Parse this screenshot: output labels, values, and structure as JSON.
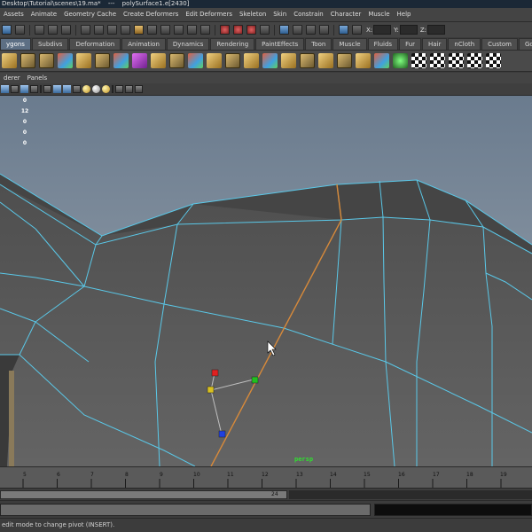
{
  "window": {
    "title_left": "Desktop\\Tutorial\\scenes\\19.ma*",
    "title_sep": "---",
    "title_right": "polySurface1.e[2430]"
  },
  "menu_bar": {
    "items": [
      "Assets",
      "Animate",
      "Geometry Cache",
      "Create Deformers",
      "Edit Deformers",
      "Skeleton",
      "Skin",
      "Constrain",
      "Character",
      "Muscle",
      "Help"
    ]
  },
  "status_line": {
    "x_label": "X:",
    "y_label": "Y:",
    "z_label": "Z:"
  },
  "shelf": {
    "tabs": [
      "ygons",
      "Subdivs",
      "Deformation",
      "Animation",
      "Dynamics",
      "Rendering",
      "PaintEffects",
      "Toon",
      "Muscle",
      "Fluids",
      "Fur",
      "Hair",
      "nCloth",
      "Custom",
      "GoZBrush"
    ],
    "active_tab": "ygons",
    "icons": [
      "polygon-cone-icon",
      "polygon-cylinder-icon",
      "polygon-cube-icon",
      "polygon-sphere-icon",
      "uv-editor-icon",
      "combine-icon",
      "extract-icon",
      "purple-cube-icon",
      "bevel-icon",
      "extrude-icon",
      "bridge-icon",
      "append-icon",
      "split-icon",
      "insert-edge-loop-icon",
      "smooth-icon",
      "merge-icon",
      "chamfer-icon",
      "wedge-icon",
      "poke-icon",
      "duplicate-face-icon",
      "crease-icon",
      "sculpt-icon",
      "checker-icon-1",
      "checker-icon-2",
      "checker-icon-3",
      "checker-icon-4",
      "gozbrush-icon"
    ]
  },
  "panel": {
    "menu_items": [
      "derer",
      "Panels"
    ],
    "hud_numbers": [
      "0",
      "12",
      "0",
      "0",
      "0"
    ],
    "camera": "persp"
  },
  "timeline": {
    "ticks": [
      "5",
      "6",
      "7",
      "8",
      "9",
      "10",
      "11",
      "12",
      "13",
      "14",
      "15",
      "16",
      "17",
      "18",
      "19"
    ]
  },
  "range_slider": {
    "end_frame": "24"
  },
  "help_line": {
    "text": "edit mode to change pivot (INSERT)."
  }
}
